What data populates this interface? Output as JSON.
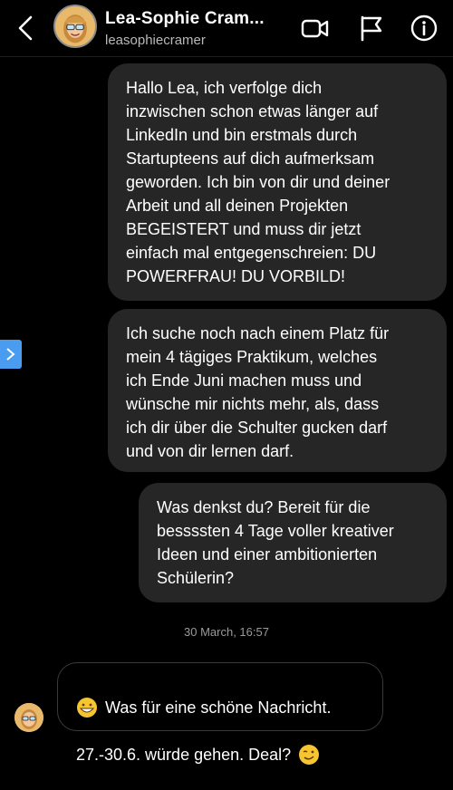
{
  "header": {
    "back_label": "back",
    "name": "Lea-Sophie Cram...",
    "username": "leasophiecramer",
    "icons": [
      "chevron-left-icon",
      "video-icon",
      "flag-icon",
      "info-icon"
    ]
  },
  "messages": [
    {
      "sender": "me",
      "text": "Hallo Lea, ich verfolge dich\ninzwischen schon etwas länger auf\nLinkedIn und bin erstmals durch\nStartupteens auf dich aufmerksam\ngeworden. Ich bin von dir und deiner\nArbeit und all deinen Projekten\nBEGEISTERT und muss dir jetzt\neinfach mal entgegenschreien: DU\nPOWERFRAU! DU VORBILD!"
    },
    {
      "sender": "me",
      "text": "Ich suche noch nach einem Platz für\nmein 4 tägiges Praktikum, welches\nich Ende Juni machen muss und\nwünsche mir nichts mehr, als, dass\nich dir über die Schulter gucken darf\nund von dir lernen darf."
    },
    {
      "sender": "me",
      "text": "Was denkst du? Bereit für die\nbessssten 4 Tage voller kreativer\nIdeen und einer ambitionierten\nSchülerin?"
    }
  ],
  "timestamp": "30 March, 16:57",
  "reply": {
    "sender": "them",
    "line1": "Was für eine schöne Nachricht.",
    "line2": "27.-30.6. würde gehen. Deal?",
    "emoji1": "grinning-face-emoji",
    "emoji2": "winking-face-emoji"
  },
  "colors": {
    "background": "#000000",
    "bubble": "#262626",
    "accent": "#4a9cf0",
    "secondary_text": "#b9b9b9"
  }
}
